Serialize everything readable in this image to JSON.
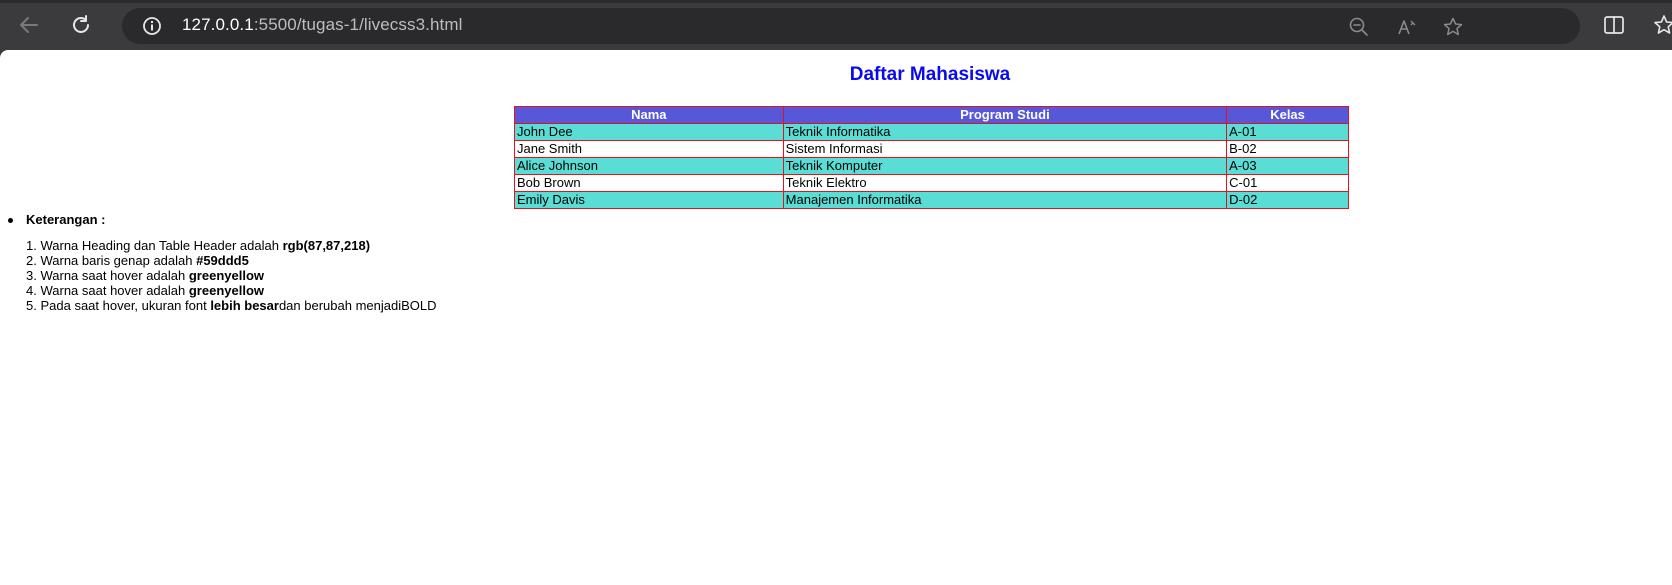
{
  "browser": {
    "url_host": "127.0.0.1",
    "url_path": ":5500/tugas-1/livecss3.html",
    "back_icon": "arrow-left-icon",
    "reload_icon": "reload-icon",
    "info_icon": "info-icon",
    "zoom_icon": "zoom-out-icon",
    "read_aloud_icon": "read-aloud-icon",
    "favorite_icon": "star-icon",
    "split_icon": "split-screen-icon",
    "favorites_icon": "favorites-icon"
  },
  "page": {
    "heading": "Daftar Mahasiswa",
    "table": {
      "headers": [
        "Nama",
        "Program Studi",
        "Kelas"
      ],
      "rows": [
        [
          "John Dee",
          "Teknik Informatika",
          "A-01"
        ],
        [
          "Jane Smith",
          "Sistem Informasi",
          "B-02"
        ],
        [
          "Alice Johnson",
          "Teknik Komputer",
          "A-03"
        ],
        [
          "Bob Brown",
          "Teknik Elektro",
          "C-01"
        ],
        [
          "Emily Davis",
          "Manajemen Informatika",
          "D-02"
        ]
      ]
    },
    "keterangan": {
      "title": "Keterangan :",
      "notes": [
        {
          "num": "1.",
          "text": "Warna Heading dan Table Header adalah ",
          "bold": "rgb(87,87,218)",
          "after": ""
        },
        {
          "num": "2.",
          "text": "Warna baris genap adalah ",
          "bold": "#59ddd5",
          "after": ""
        },
        {
          "num": "3.",
          "text": "Warna saat hover adalah ",
          "bold": "greenyellow",
          "after": ""
        },
        {
          "num": "4.",
          "text": "Warna saat hover adalah ",
          "bold": "greenyellow",
          "after": ""
        },
        {
          "num": "5.",
          "text": "Pada saat hover, ukuran font ",
          "bold": "lebih besar",
          "after": "dan berubah menjadiBOLD"
        }
      ]
    }
  },
  "colors": {
    "heading": "#0a0af0",
    "table_header": "#5757da",
    "odd_row": "#59ddd5",
    "table_border": "#e0141e"
  }
}
